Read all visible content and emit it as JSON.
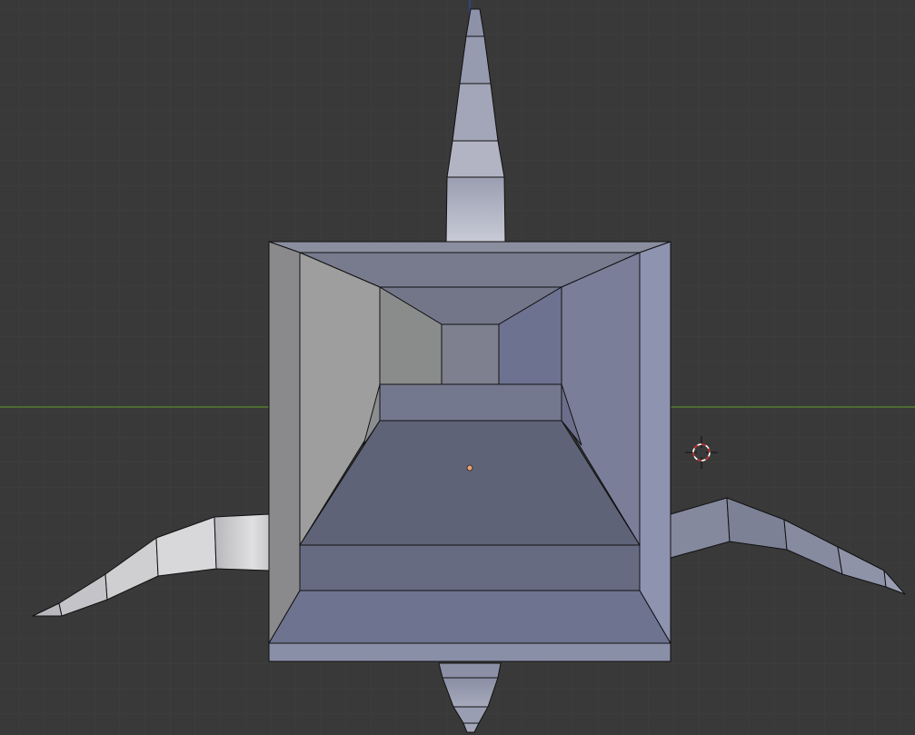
{
  "viewport": {
    "background_color": "#393939",
    "grid_color": "#3f3f3f",
    "x_axis_color": "#5a8a2e",
    "z_axis_color": "#2a4a9a",
    "mesh_base_color": "#6c7088",
    "origin_color": "#f0a070",
    "cursor_colors": [
      "#d03030",
      "#ffffff"
    ]
  },
  "scene": {
    "object": "hollow-box-with-spikes",
    "spike_count": 4,
    "icons": [
      "3d-cursor-icon",
      "object-origin-icon"
    ]
  }
}
